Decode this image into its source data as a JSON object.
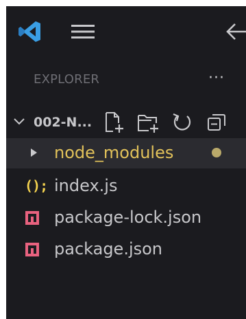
{
  "topbar": {
    "logo_icon": "vscode-logo",
    "menu_icon": "hamburger-menu-icon",
    "back_icon": "arrow-left-icon"
  },
  "explorer": {
    "title": "EXPLORER",
    "more_label": "···"
  },
  "folder": {
    "name": "002-N...",
    "expanded": true,
    "actions": [
      {
        "name": "new-file",
        "icon": "new-file-icon"
      },
      {
        "name": "new-folder",
        "icon": "new-folder-icon"
      },
      {
        "name": "refresh",
        "icon": "refresh-icon"
      },
      {
        "name": "collapse-all",
        "icon": "collapse-all-icon"
      }
    ]
  },
  "tree": {
    "items": [
      {
        "label": "node_modules",
        "type": "folder",
        "icon": "chevron-right-icon",
        "modified": true
      },
      {
        "label": "index.js",
        "type": "file",
        "icon": "js-file-icon"
      },
      {
        "label": "package-lock.json",
        "type": "file",
        "icon": "json-file-icon"
      },
      {
        "label": "package.json",
        "type": "file",
        "icon": "json-file-icon"
      }
    ]
  },
  "colors": {
    "background": "#1b1b1f",
    "accent_blue": "#3a9ee4",
    "folder_yellow": "#e2c25a",
    "modified_dot": "#b9a96a",
    "json_pink": "#e8627f",
    "text": "#c7c7ca",
    "muted": "#6e6e74"
  }
}
